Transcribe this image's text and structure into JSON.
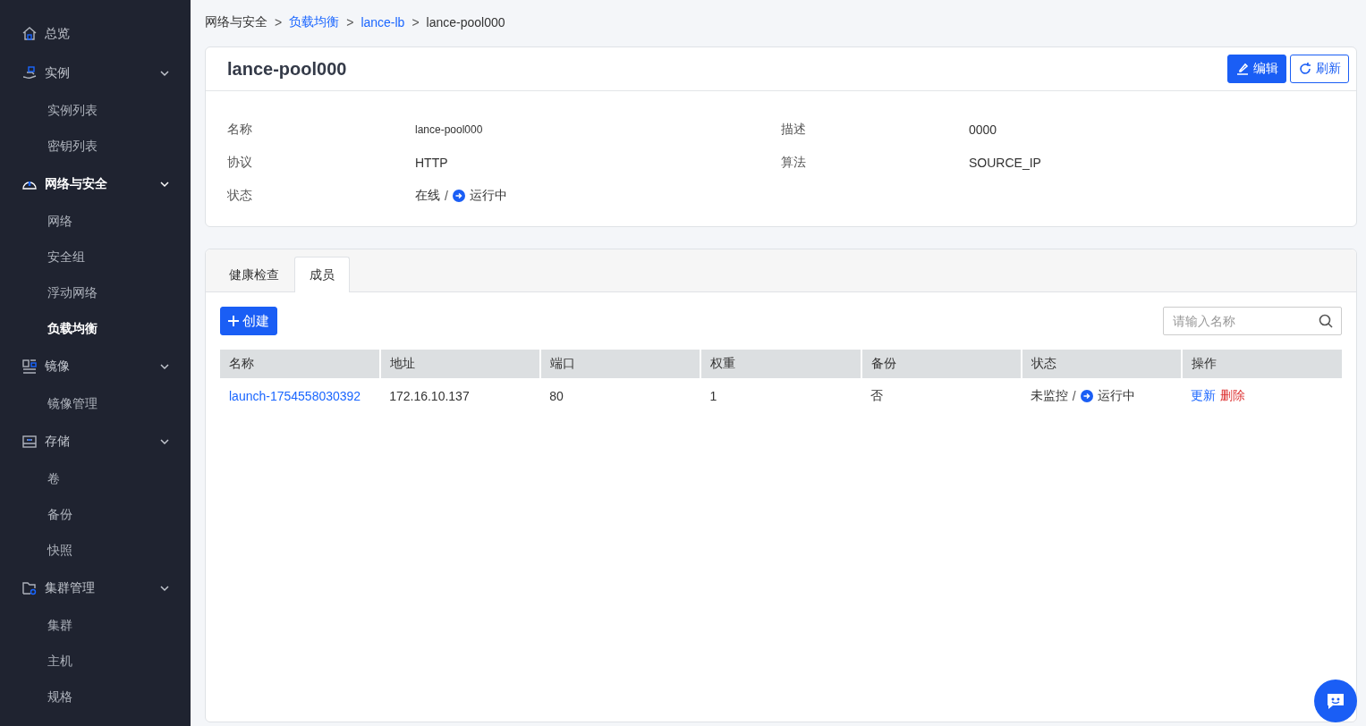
{
  "sidebar": {
    "items": [
      {
        "label": "总览",
        "kind": "home",
        "selected": false
      },
      {
        "label": "实例",
        "kind": "server",
        "selected": false,
        "expanded": true,
        "children": [
          {
            "label": "实例列表",
            "selected": false
          },
          {
            "label": "密钥列表",
            "selected": false
          }
        ]
      },
      {
        "label": "网络与安全",
        "kind": "gauge",
        "selected": true,
        "expanded": true,
        "children": [
          {
            "label": "网络",
            "selected": false
          },
          {
            "label": "安全组",
            "selected": false
          },
          {
            "label": "浮动网络",
            "selected": false
          },
          {
            "label": "负载均衡",
            "selected": true
          }
        ]
      },
      {
        "label": "镜像",
        "kind": "image",
        "selected": false,
        "expanded": true,
        "children": [
          {
            "label": "镜像管理",
            "selected": false
          }
        ]
      },
      {
        "label": "存储",
        "kind": "storage",
        "selected": false,
        "expanded": true,
        "children": [
          {
            "label": "卷",
            "selected": false
          },
          {
            "label": "备份",
            "selected": false
          },
          {
            "label": "快照",
            "selected": false
          }
        ]
      },
      {
        "label": "集群管理",
        "kind": "folder",
        "selected": false,
        "expanded": true,
        "children": [
          {
            "label": "集群",
            "selected": false
          },
          {
            "label": "主机",
            "selected": false
          },
          {
            "label": "规格",
            "selected": false
          }
        ]
      }
    ]
  },
  "breadcrumb": [
    {
      "label": "网络与安全",
      "link": false
    },
    {
      "label": "负载均衡",
      "link": true
    },
    {
      "label": "lance-lb",
      "link": true
    },
    {
      "label": "lance-pool000",
      "link": false
    }
  ],
  "breadcrumb_separator": ">",
  "detail": {
    "title": "lance-pool000",
    "buttons": [
      {
        "label": "编辑",
        "kind": "primary"
      },
      {
        "label": "刷新",
        "kind": "outline"
      }
    ],
    "columns": [
      [
        {
          "label": "名称",
          "kind": "small",
          "value": "lance-pool000"
        },
        {
          "label": "协议",
          "kind": "text",
          "value": "HTTP"
        },
        {
          "label": "状态",
          "kind": "status",
          "value": "在线",
          "separator": "/",
          "status": "运行中"
        }
      ],
      [
        {
          "label": "描述",
          "kind": "text",
          "value": "0000"
        },
        {
          "label": "算法",
          "kind": "text",
          "value": "SOURCE_IP"
        }
      ]
    ]
  },
  "tabs": [
    {
      "label": "健康检查",
      "selected": false
    },
    {
      "label": "成员",
      "selected": true
    }
  ],
  "create_button": "创建",
  "search": {
    "placeholder": "请输入名称"
  },
  "table": {
    "columns": [
      "名称",
      "地址",
      "端口",
      "权重",
      "备份",
      "状态",
      "操作"
    ],
    "rows": [
      {
        "name": "launch-1754558030392",
        "address": "172.16.10.137",
        "port": "80",
        "weight": "1",
        "backup": "否",
        "monitor": "未监控",
        "separator": "/",
        "status": "运行中",
        "actions": [
          {
            "label": "更新",
            "kind": "link"
          },
          {
            "label": "删除",
            "kind": "danger"
          }
        ]
      }
    ]
  }
}
